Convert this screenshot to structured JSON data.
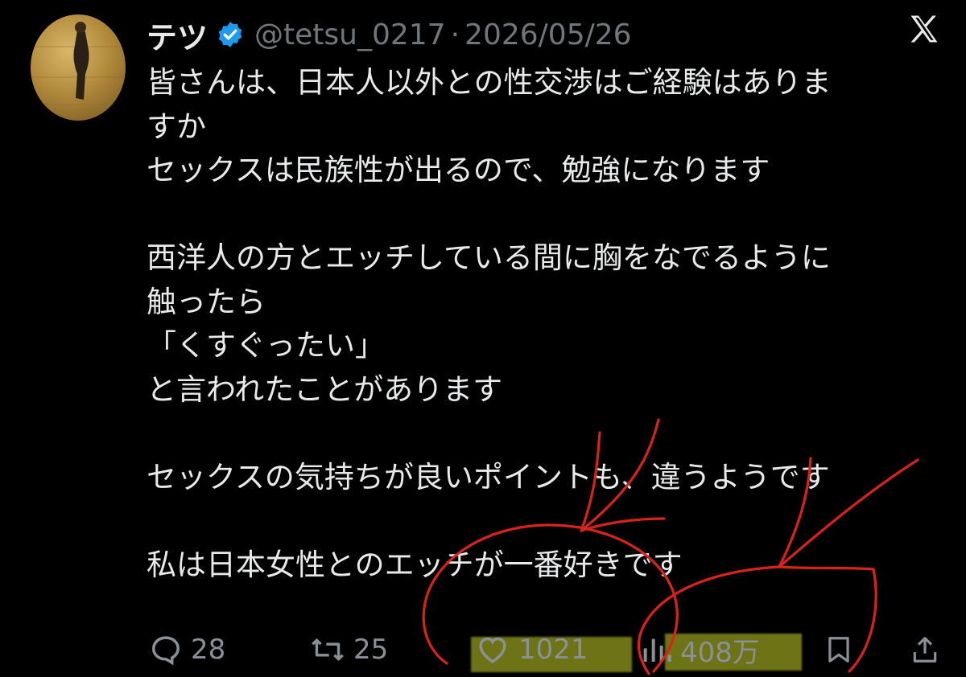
{
  "tweet": {
    "display_name": "テツ",
    "handle": "@tetsu_0217",
    "separator": "·",
    "date": "2026/05/26",
    "body": "皆さんは、日本人以外との性交渉はご経験はありま\nすか\nセックスは民族性が出るので、勉強になります\n\n西洋人の方とエッチしている間に胸をなでるように\n触ったら\n「くすぐったい」\nと言われたことがあります\n\nセックスの気持ちが良いポイントも、違うようです\n\n私は日本女性とのエッチが一番好きです"
  },
  "actions": {
    "replies": "28",
    "retweets": "25",
    "likes": "1021",
    "views": "408万"
  },
  "icons": {
    "verified": "verified-badge-icon",
    "platform": "x-logo-icon",
    "reply": "reply-icon",
    "retweet": "retweet-icon",
    "like": "heart-icon",
    "views": "views-bar-chart-icon",
    "bookmark": "bookmark-icon",
    "share": "share-icon"
  },
  "colors": {
    "background": "#000000",
    "text": "#e7e9ea",
    "muted": "#71767b",
    "verified": "#1d9bf0",
    "annotation": "#d8231b",
    "highlight": "#c8d228"
  }
}
